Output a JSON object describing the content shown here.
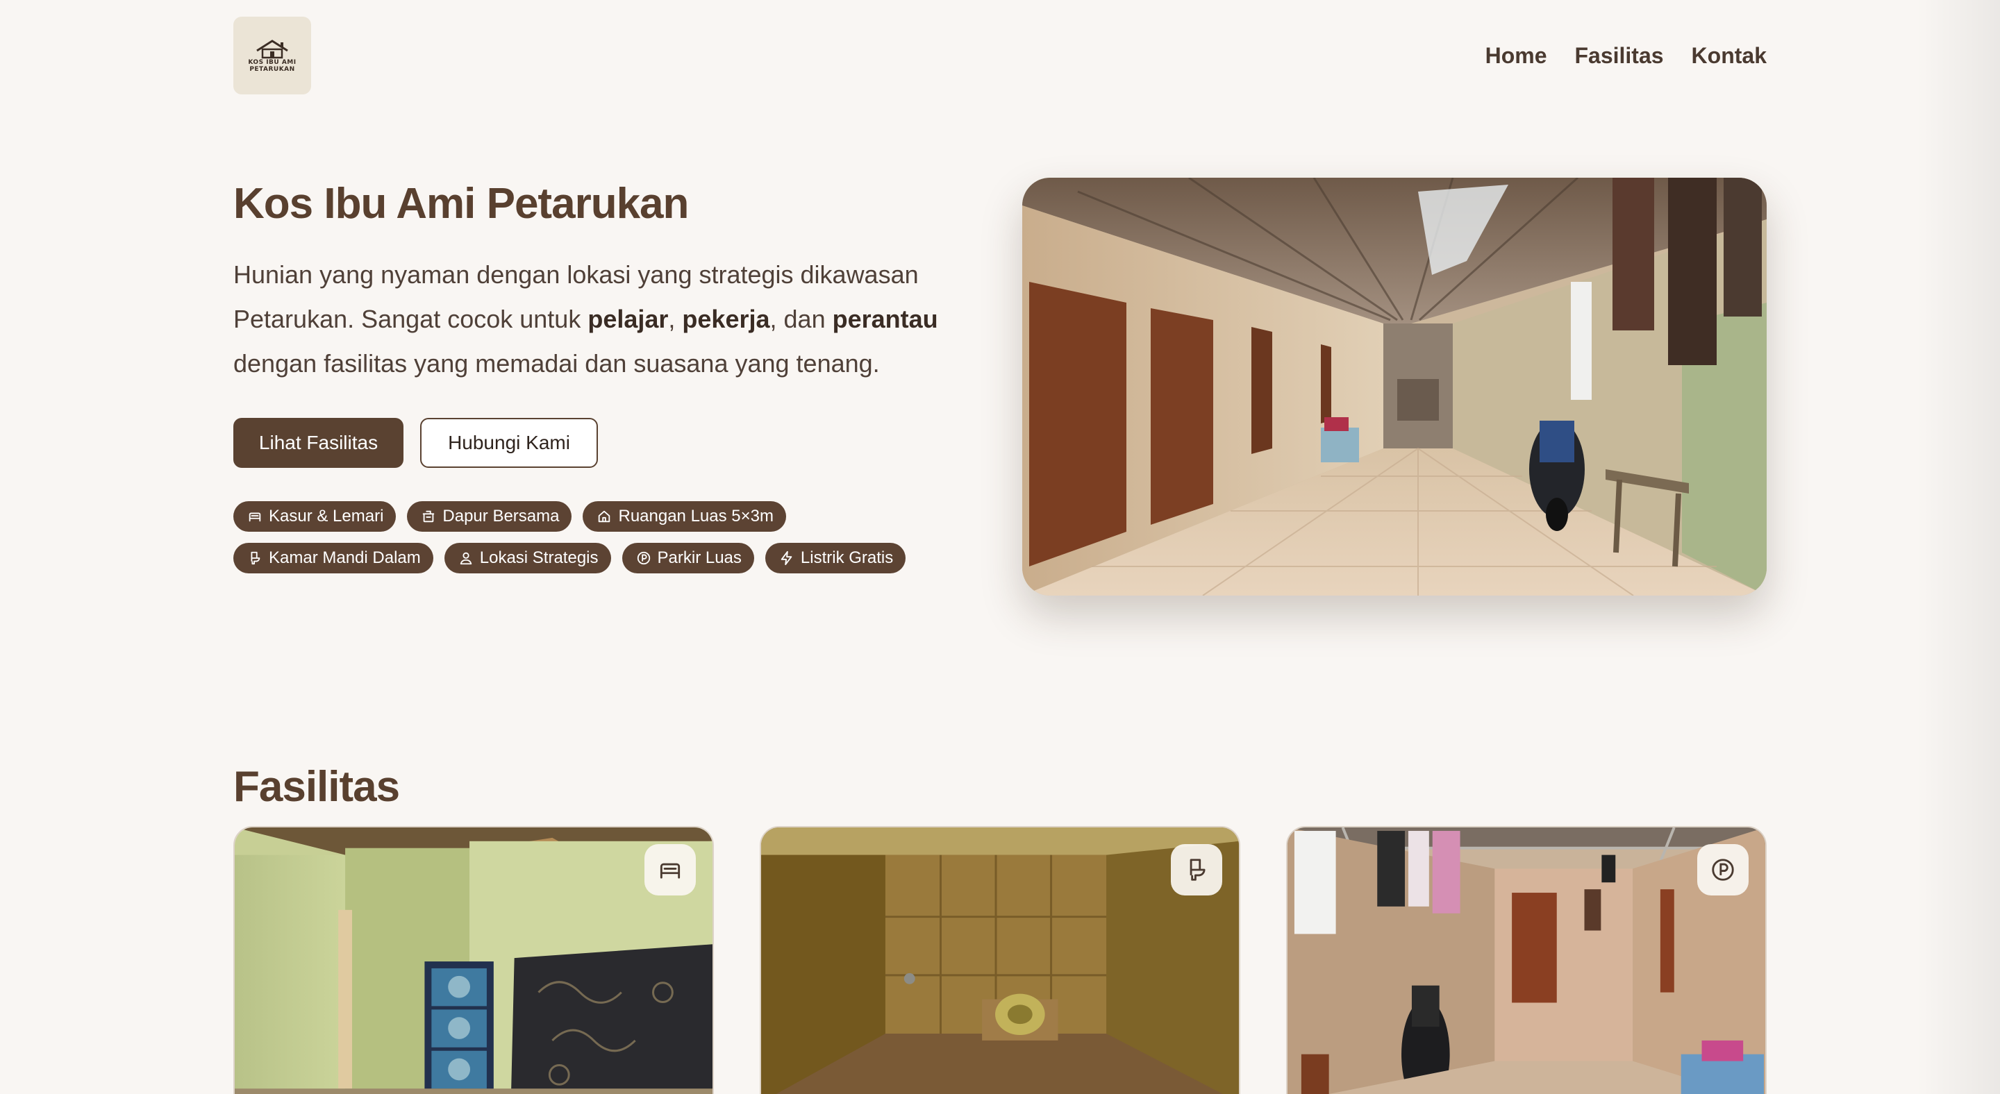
{
  "header": {
    "logo_line1": "KOS IBU AMI",
    "logo_line2": "PETARUKAN",
    "nav": [
      "Home",
      "Fasilitas",
      "Kontak"
    ]
  },
  "hero": {
    "title": "Kos Ibu Ami Petarukan",
    "desc_part1": "Hunian yang nyaman dengan lokasi yang strategis dikawasan",
    "desc_part2": "Petarukan. Sangat cocok untuk ",
    "desc_bold1": "pelajar",
    "desc_sep1": ", ",
    "desc_bold2": "pekerja",
    "desc_sep2": ", dan ",
    "desc_bold3": "perantau",
    "desc_part3": "dengan fasilitas yang memadai dan suasana yang tenang.",
    "primary_button": "Lihat Fasilitas",
    "secondary_button": "Hubungi Kami",
    "chips": [
      {
        "label": "Kasur & Lemari",
        "icon": "bed-icon"
      },
      {
        "label": "Dapur Bersama",
        "icon": "kitchen-icon"
      },
      {
        "label": "Ruangan Luas 5×3m",
        "icon": "home-icon"
      },
      {
        "label": "Kamar Mandi Dalam",
        "icon": "toilet-icon"
      },
      {
        "label": "Lokasi Strategis",
        "icon": "user-location-icon"
      },
      {
        "label": "Parkir Luas",
        "icon": "parking-icon"
      },
      {
        "label": "Listrik Gratis",
        "icon": "lightning-icon"
      }
    ]
  },
  "facilities": {
    "title": "Fasilitas",
    "cards": [
      {
        "icon": "bed-icon"
      },
      {
        "icon": "toilet-icon"
      },
      {
        "icon": "parking-icon"
      }
    ]
  },
  "colors": {
    "background": "#f9f6f3",
    "brand_brown": "#5a4231",
    "heading": "#59402f",
    "logo_bg": "#ebe4d6"
  }
}
